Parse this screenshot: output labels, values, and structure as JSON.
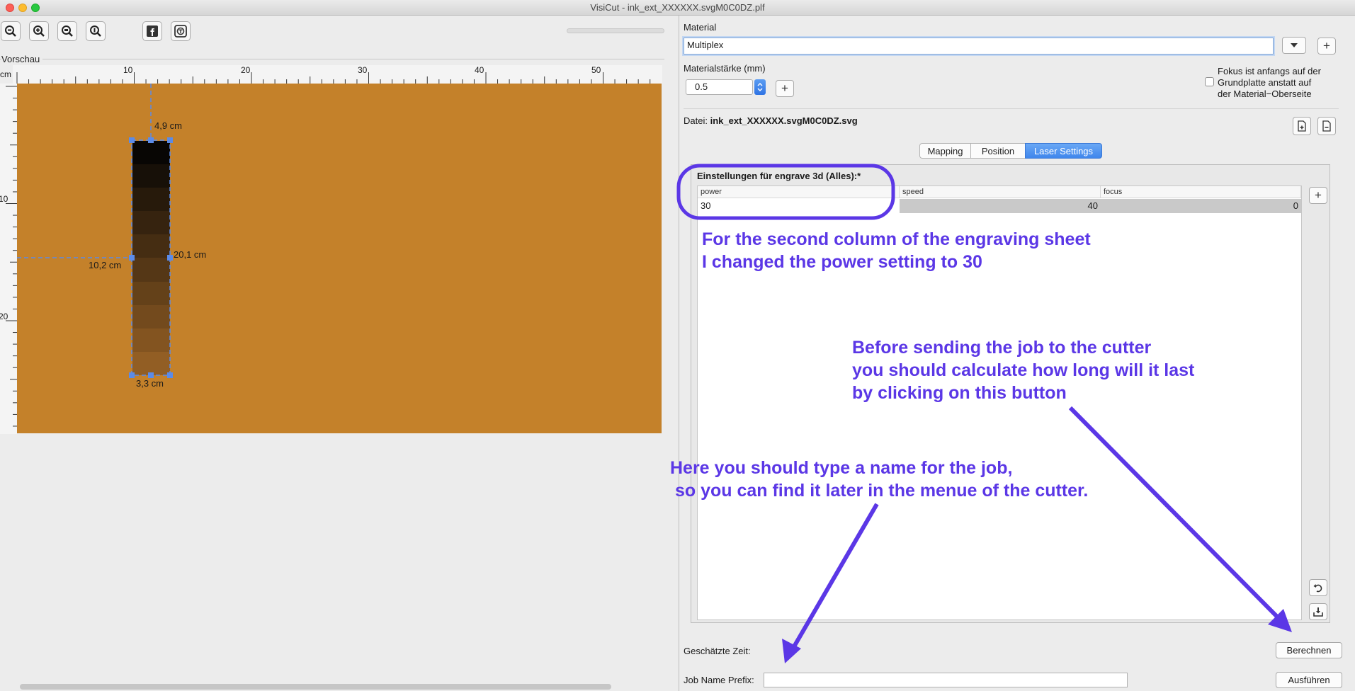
{
  "window": {
    "title": "VisiCut - ink_ext_XXXXXX.svgM0C0DZ.plf"
  },
  "toolbar": {
    "buttons": [
      {
        "name": "zoom-out-icon"
      },
      {
        "name": "zoom-in-icon"
      },
      {
        "name": "zoom-fit-icon"
      },
      {
        "name": "zoom-actual-icon"
      },
      {
        "name": "facebook-icon"
      },
      {
        "name": "thingiverse-icon"
      }
    ]
  },
  "preview": {
    "label": "Vorschau",
    "unit": "cm",
    "ruler_top_ticks": [
      "10",
      "20",
      "30",
      "40",
      "50"
    ],
    "ruler_left_ticks": [
      "10",
      "20"
    ],
    "material_color": "#c4812a",
    "object": {
      "width_label": "3,3 cm",
      "height_label": "20,1 cm",
      "x_label": "10,2 cm",
      "y_label": "4,9 cm",
      "gradient_steps": 10
    }
  },
  "material": {
    "label": "Material",
    "value": "Multiplex",
    "thickness_label": "Materialstärke (mm)",
    "thickness_value": "0.5",
    "focus_checkbox_label_1": "Fokus ist anfangs auf der",
    "focus_checkbox_label_2": "Grundplatte anstatt auf",
    "focus_checkbox_label_3": "der Material−Oberseite",
    "focus_checked": false
  },
  "file": {
    "prefix": "Datei:",
    "name": "ink_ext_XXXXXX.svgM0C0DZ.svg"
  },
  "tabs": [
    {
      "label": "Mapping",
      "active": false
    },
    {
      "label": "Position",
      "active": false
    },
    {
      "label": "Laser Settings",
      "active": true
    }
  ],
  "laser_settings": {
    "title": "Einstellungen für engrave 3d (Alles):*",
    "columns": [
      "power",
      "speed",
      "focus"
    ],
    "row": {
      "power": "30",
      "speed": "40",
      "focus": "0"
    }
  },
  "annotations": {
    "power_note": "For the second column of the engraving sheet\nI changed the power setting to 30",
    "calc_note": "Before sending the job to the cutter\nyou should calculate how long will it last\nby clicking on this button",
    "name_note": "Here you should type a name for the job,\n so you can find it later in the menue of the cutter.",
    "color": "#5b37e6"
  },
  "footer": {
    "estimated_time_label": "Geschätzte Zeit:",
    "calculate_button": "Berechnen",
    "job_prefix_label": "Job Name Prefix:",
    "job_prefix_value": "",
    "execute_button": "Ausführen"
  }
}
